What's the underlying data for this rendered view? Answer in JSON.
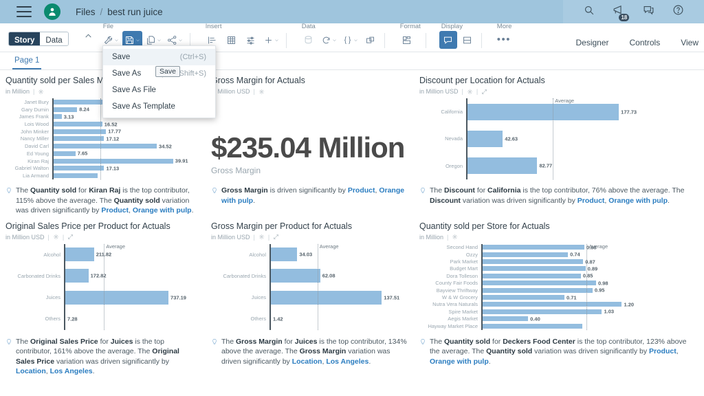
{
  "header": {
    "breadcrumb_root": "Files",
    "breadcrumb_sep": "/",
    "breadcrumb_current": "best run juice",
    "notification_count": "18"
  },
  "toolbar": {
    "mode_story": "Story",
    "mode_data": "Data",
    "groups": [
      {
        "label": "File"
      },
      {
        "label": "Insert"
      },
      {
        "label": "Data"
      },
      {
        "label": "Format"
      },
      {
        "label": "Display"
      },
      {
        "label": "More"
      }
    ],
    "right": [
      "Designer",
      "Controls",
      "View"
    ]
  },
  "page_tabs": {
    "active": "Page 1"
  },
  "save_menu": {
    "items": [
      {
        "label": "Save",
        "shortcut": "(Ctrl+S)",
        "highlighted": true
      },
      {
        "label": "Save As",
        "shortcut": "(Ctrl+Shift+S)",
        "highlighted": false
      },
      {
        "label": "Save As File",
        "shortcut": "",
        "highlighted": false
      },
      {
        "label": "Save As Template",
        "shortcut": "",
        "highlighted": false
      }
    ],
    "tooltip": "Save"
  },
  "colors": {
    "bar": "#93bddf",
    "link": "#2b7dc0",
    "accent": "#3f7ab0",
    "header_bg": "#9fc5dd"
  },
  "chart_data": [
    {
      "id": "quantity-per-sales-manager",
      "type": "bar",
      "title": "Quantity sold per Sales Manager for Actuals",
      "unit": "in Million",
      "orientation": "horizontal",
      "average_label": "Average",
      "average": 16.0,
      "xlim": [
        0,
        42
      ],
      "categories": [
        "Janet Bury",
        "Gary Dumin",
        "James Frank",
        "Lois Wood",
        "John Minker",
        "Nancy Miller",
        "David Carl",
        "Ed Young",
        "Kiran Raj",
        "Gabriel Walton",
        "Lia Armand"
      ],
      "values": [
        20.0,
        8.24,
        3.13,
        16.52,
        17.77,
        17.12,
        34.52,
        7.65,
        39.91,
        17.13,
        15.0
      ],
      "labels": [
        "",
        "8.24",
        "3.13",
        "16.52",
        "17.77",
        "17.12",
        "34.52",
        "7.65",
        "39.91",
        "17.13",
        ""
      ]
    },
    {
      "id": "gross-margin-kpi",
      "type": "kpi",
      "title": "Gross Margin for Actuals",
      "unit": "in Million USD",
      "value": "$235.04 Million",
      "label": "Gross Margin"
    },
    {
      "id": "discount-per-location",
      "type": "bar",
      "title": "Discount per Location for Actuals",
      "unit": "in Million USD",
      "orientation": "horizontal",
      "average_label": "Average",
      "average": 101.04,
      "xlim": [
        0,
        200
      ],
      "categories": [
        "California",
        "Nevada",
        "Oregon"
      ],
      "values": [
        177.73,
        42.63,
        82.77
      ],
      "labels": [
        "177.73",
        "42.63",
        "82.77"
      ]
    },
    {
      "id": "original-sales-price-per-product",
      "type": "bar",
      "title": "Original Sales Price per Product for Actuals",
      "unit": "in Million USD",
      "orientation": "horizontal",
      "average_label": "Average",
      "average": 282.28,
      "xlim": [
        0,
        800
      ],
      "categories": [
        "Alcohol",
        "Carbonated Drinks",
        "Juices",
        "Others"
      ],
      "values": [
        211.82,
        172.82,
        737.19,
        7.28
      ],
      "labels": [
        "211.82",
        "172.82",
        "737.19",
        "7.28"
      ]
    },
    {
      "id": "gross-margin-per-product",
      "type": "bar",
      "title": "Gross Margin per Product for Actuals",
      "unit": "in Million USD",
      "orientation": "horizontal",
      "average_label": "Average",
      "average": 58.76,
      "xlim": [
        0,
        160
      ],
      "categories": [
        "Alcohol",
        "Carbonated Drinks",
        "Juices",
        "Others"
      ],
      "values": [
        34.03,
        62.08,
        137.51,
        1.42
      ],
      "labels": [
        "34.03",
        "62.08",
        "137.51",
        "1.42"
      ]
    },
    {
      "id": "quantity-per-store",
      "type": "bar",
      "title": "Quantity sold per Store for Actuals",
      "unit": "in Million",
      "orientation": "horizontal",
      "average_label": "Average",
      "average": 0.9,
      "xlim": [
        0,
        1.35
      ],
      "categories": [
        "Second Hand",
        "Ozzy",
        "Park Market",
        "Budget Mart",
        "Dora Tolleson",
        "County Fair Foods",
        "Bayview Thriftway",
        "W & W Grocery",
        "Nutra Vera Naturals",
        "Spire Market",
        "Aegis Market",
        "Hayway Market Place"
      ],
      "values": [
        0.88,
        0.74,
        0.87,
        0.89,
        0.85,
        0.98,
        0.95,
        0.71,
        1.2,
        1.03,
        0.4,
        0.86
      ],
      "labels": [
        "0.88",
        "0.74",
        "0.87",
        "0.89",
        "0.85",
        "0.98",
        "0.95",
        "0.71",
        "1.20",
        "1.03",
        "0.40",
        ""
      ]
    }
  ],
  "insights": [
    {
      "id": "insight-quantity-sales-manager",
      "parts": [
        {
          "t": "The "
        },
        {
          "t": "Quantity sold",
          "s": "b"
        },
        {
          "t": " for "
        },
        {
          "t": "Kiran Raj",
          "s": "b"
        },
        {
          "t": " is the top contributor, 115% above the average. The "
        },
        {
          "t": "Quantity sold",
          "s": "b"
        },
        {
          "t": " variation was driven significantly by "
        },
        {
          "t": "Product",
          "s": "a"
        },
        {
          "t": ", "
        },
        {
          "t": "Orange with pulp",
          "s": "a"
        },
        {
          "t": "."
        }
      ]
    },
    {
      "id": "insight-gross-margin",
      "parts": [
        {
          "t": "Gross Margin",
          "s": "b"
        },
        {
          "t": " is driven significantly by "
        },
        {
          "t": "Product",
          "s": "a"
        },
        {
          "t": ", "
        },
        {
          "t": "Orange with pulp",
          "s": "a"
        },
        {
          "t": "."
        }
      ]
    },
    {
      "id": "insight-discount-location",
      "parts": [
        {
          "t": "The "
        },
        {
          "t": "Discount",
          "s": "b"
        },
        {
          "t": " for "
        },
        {
          "t": "California",
          "s": "b"
        },
        {
          "t": " is the top contributor, 76% above the average. The "
        },
        {
          "t": "Discount",
          "s": "b"
        },
        {
          "t": " variation was driven significantly by "
        },
        {
          "t": "Product",
          "s": "a"
        },
        {
          "t": ", "
        },
        {
          "t": "Orange with pulp",
          "s": "a"
        },
        {
          "t": "."
        }
      ]
    },
    {
      "id": "insight-original-sales-price",
      "parts": [
        {
          "t": "The "
        },
        {
          "t": "Original Sales Price",
          "s": "b"
        },
        {
          "t": " for "
        },
        {
          "t": "Juices",
          "s": "b"
        },
        {
          "t": " is the top contributor, 161% above the average. The "
        },
        {
          "t": "Original Sales Price",
          "s": "b"
        },
        {
          "t": " variation was driven significantly by "
        },
        {
          "t": "Location",
          "s": "a"
        },
        {
          "t": ", "
        },
        {
          "t": "Los Angeles",
          "s": "a"
        },
        {
          "t": "."
        }
      ]
    },
    {
      "id": "insight-gross-margin-product",
      "parts": [
        {
          "t": "The "
        },
        {
          "t": "Gross Margin",
          "s": "b"
        },
        {
          "t": " for "
        },
        {
          "t": "Juices",
          "s": "b"
        },
        {
          "t": " is the top contributor, 134% above the average. The "
        },
        {
          "t": "Gross Margin",
          "s": "b"
        },
        {
          "t": " variation was driven significantly by "
        },
        {
          "t": "Location",
          "s": "a"
        },
        {
          "t": ", "
        },
        {
          "t": "Los Angeles",
          "s": "a"
        },
        {
          "t": "."
        }
      ]
    },
    {
      "id": "insight-quantity-store",
      "parts": [
        {
          "t": "The "
        },
        {
          "t": "Quantity sold",
          "s": "b"
        },
        {
          "t": " for "
        },
        {
          "t": "Deckers Food Center",
          "s": "b"
        },
        {
          "t": " is the top contributor, 123% above the average. The "
        },
        {
          "t": "Quantity sold",
          "s": "b"
        },
        {
          "t": " variation was driven significantly by "
        },
        {
          "t": "Product",
          "s": "a"
        },
        {
          "t": ", "
        },
        {
          "t": "Orange with pulp",
          "s": "a"
        },
        {
          "t": "."
        }
      ]
    }
  ]
}
